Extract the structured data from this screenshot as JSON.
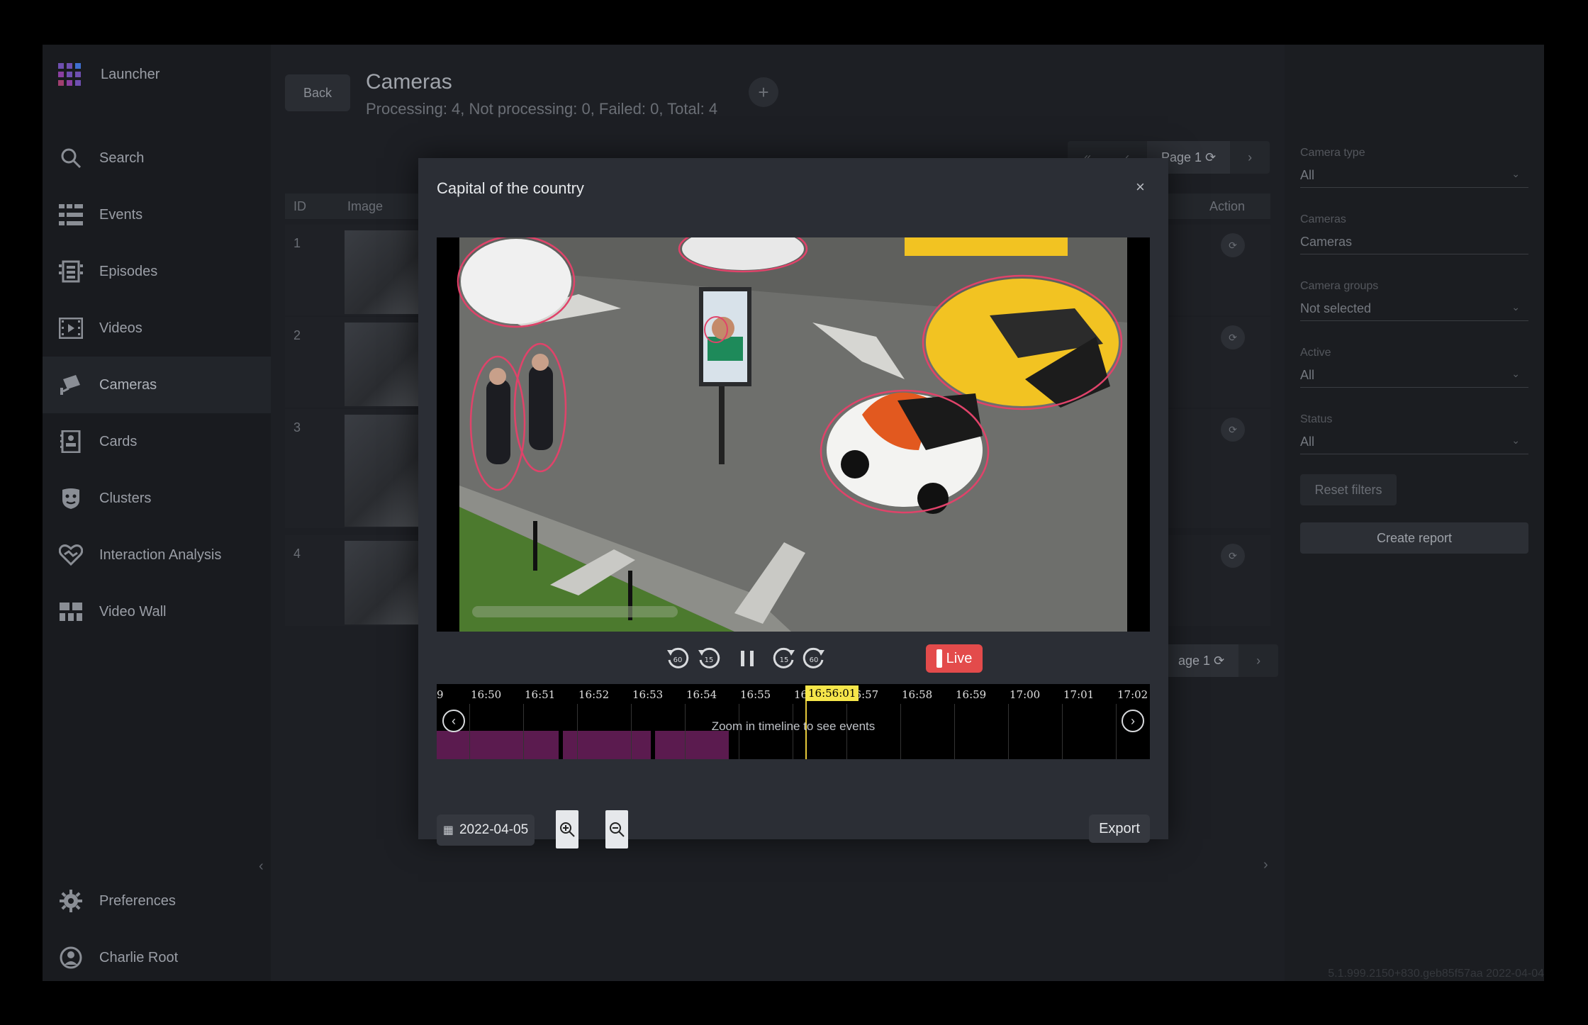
{
  "sidebar": {
    "launcher_label": "Launcher",
    "items": [
      {
        "label": "Search",
        "icon": "search-icon"
      },
      {
        "label": "Events",
        "icon": "events-icon"
      },
      {
        "label": "Episodes",
        "icon": "episodes-icon"
      },
      {
        "label": "Videos",
        "icon": "videos-icon"
      },
      {
        "label": "Cameras",
        "icon": "cameras-icon",
        "active": true
      },
      {
        "label": "Cards",
        "icon": "cards-icon"
      },
      {
        "label": "Clusters",
        "icon": "clusters-icon"
      },
      {
        "label": "Interaction Analysis",
        "icon": "interaction-icon"
      },
      {
        "label": "Video Wall",
        "icon": "video-wall-icon"
      }
    ],
    "preferences_label": "Preferences",
    "user_label": "Charlie Root"
  },
  "header": {
    "back_label": "Back",
    "title": "Cameras",
    "subtitle": "Processing: 4, Not processing: 0, Failed: 0, Total: 4",
    "add_label": "+"
  },
  "pager": {
    "top_page": "Page 1",
    "bottom_page": "age 1"
  },
  "table": {
    "col_id": "ID",
    "col_image": "Image",
    "col_action": "Action",
    "row_ids": [
      "1",
      "2",
      "3",
      "4"
    ]
  },
  "filters": {
    "camera_type_label": "Camera type",
    "camera_type_value": "All",
    "cameras_label": "Cameras",
    "cameras_value": "Cameras",
    "camera_groups_label": "Camera groups",
    "camera_groups_value": "Not selected",
    "active_label": "Active",
    "active_value": "All",
    "status_label": "Status",
    "status_value": "All",
    "reset_label": "Reset filters",
    "report_label": "Create report"
  },
  "version": "5.1.999.2150+830.geb85f57aa 2022-04-04",
  "modal": {
    "title": "Capital of the country",
    "close": "×",
    "controls": {
      "back60": "60",
      "back15": "15",
      "fwd15": "15",
      "fwd60": "60",
      "live_label": "Live"
    },
    "timeline": {
      "ticks": [
        "9",
        "16:50",
        "16:51",
        "16:52",
        "16:53",
        "16:54",
        "16:55",
        "16:",
        "16:57",
        "16:58",
        "16:59",
        "17:00",
        "17:01",
        "17:02"
      ],
      "current_time": "16:56:01",
      "hint": "Zoom in timeline to see events"
    },
    "date": "2022-04-05",
    "export_label": "Export"
  }
}
